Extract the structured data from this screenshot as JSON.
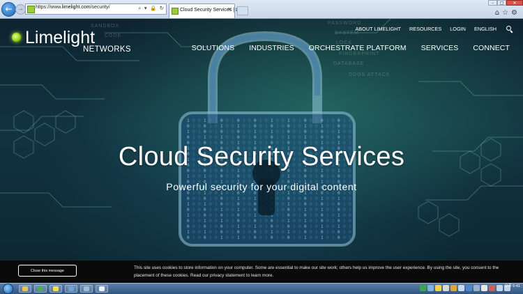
{
  "browser": {
    "url_prefix": "https://www.",
    "url_host": "limelight.com",
    "url_path": "/security/",
    "address_tools": "⌕ ▾ 🔒 ↻",
    "tab_title": "Cloud Security Services | L...",
    "tab_close": "✕",
    "back_glyph": "←",
    "forward_glyph": "→",
    "window_controls": [
      "–",
      "□",
      "✕"
    ],
    "toolbar_icons": "⌂☆⚙"
  },
  "site": {
    "logo_word": "Limelight",
    "logo_sub": "NETWORKS",
    "utility_nav": [
      "ABOUT LIMELIGHT",
      "RESOURCES",
      "LOGIN",
      "ENGLISH"
    ],
    "main_nav": [
      "SOLUTIONS",
      "INDUSTRIES",
      "ORCHESTRATE PLATFORM",
      "SERVICES",
      "CONNECT"
    ],
    "hero_title": "Cloud Security Services",
    "hero_subtitle": "Powerful security for your digital content",
    "background_words": [
      "SANDBOX",
      "CODE",
      "PASSWORD",
      "SYSTEM",
      "LOCK",
      "FINGERPRINT",
      "DATABASE",
      "DDOS ATTACK"
    ]
  },
  "cookie": {
    "button_label": "Close this message",
    "text": "This site uses cookies to store information on your computer. Some are essential to make our site work; others help us improve the user experience. By using the site, you consent to the placement of these cookies. Read our privacy statement to learn more."
  },
  "taskbar": {
    "clock_line1": "오후 5:41",
    "clock_line2": ""
  },
  "colors": {
    "accent_green": "#9bd31c",
    "cookie_bg": "#0a0a0a",
    "hero_bg": "#123341"
  },
  "icons": [
    "back-arrow-icon",
    "forward-arrow-icon",
    "search-icon",
    "lock-icon",
    "refresh-icon",
    "home-icon",
    "star-icon",
    "gear-icon",
    "padlock-illustration"
  ]
}
